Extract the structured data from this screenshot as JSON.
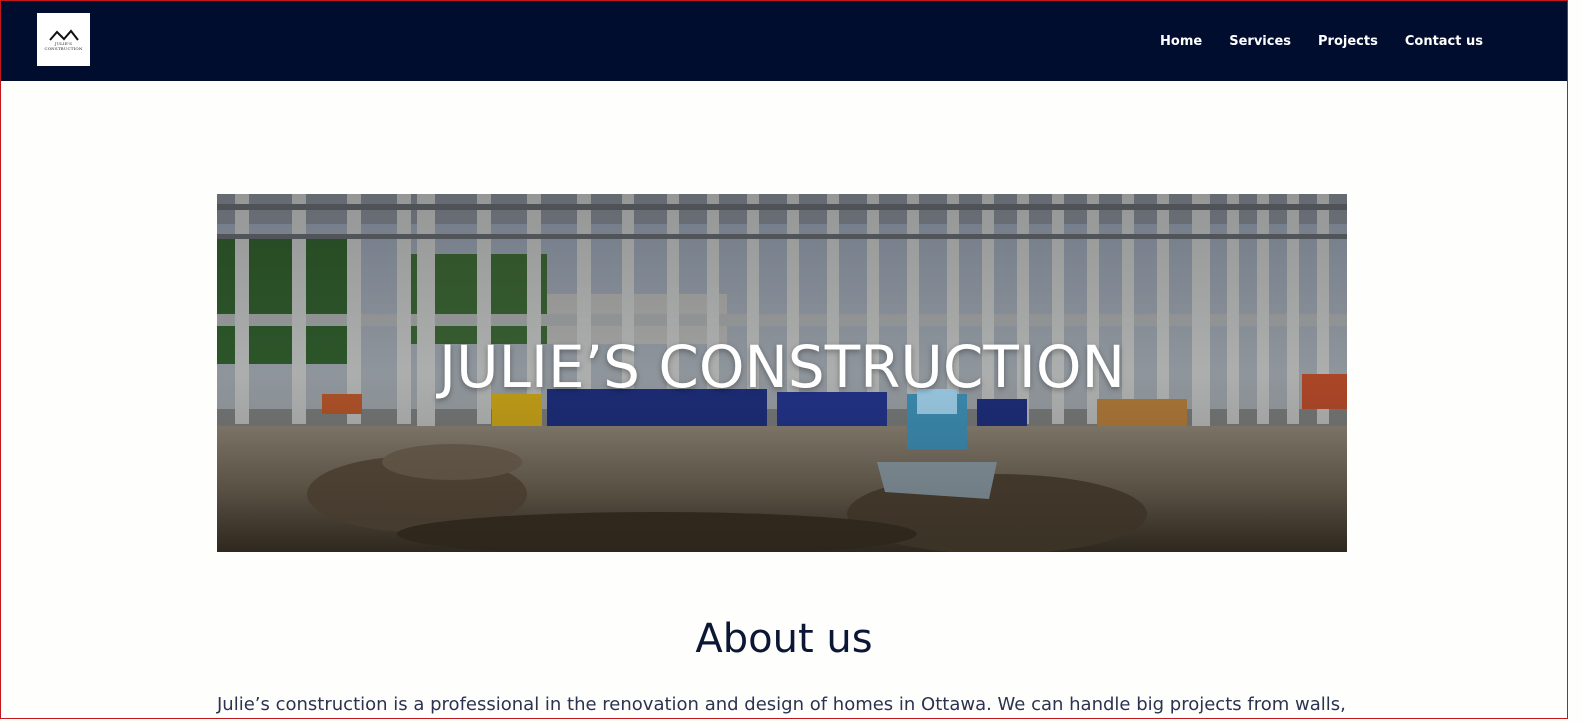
{
  "brand": {
    "logo_text_line1": "JULIE'S",
    "logo_text_line2": "CONSTRUCTION"
  },
  "nav": {
    "items": [
      {
        "label": "Home"
      },
      {
        "label": "Services"
      },
      {
        "label": "Projects"
      },
      {
        "label": "Contact us"
      }
    ]
  },
  "hero": {
    "title": "JULIE’S CONSTRUCTION",
    "image_subject": "construction site with concrete frame, bulldozer and gravel"
  },
  "about": {
    "heading": "About us",
    "text": "Julie’s construction is a professional in the renovation and design of homes in Ottawa. We can handle big projects from walls,"
  },
  "colors": {
    "navbar_bg": "#000d2e",
    "page_bg": "#fefefc",
    "heading": "#0b1735",
    "body_text": "#2b3350",
    "frame_border": "#c4161c"
  }
}
